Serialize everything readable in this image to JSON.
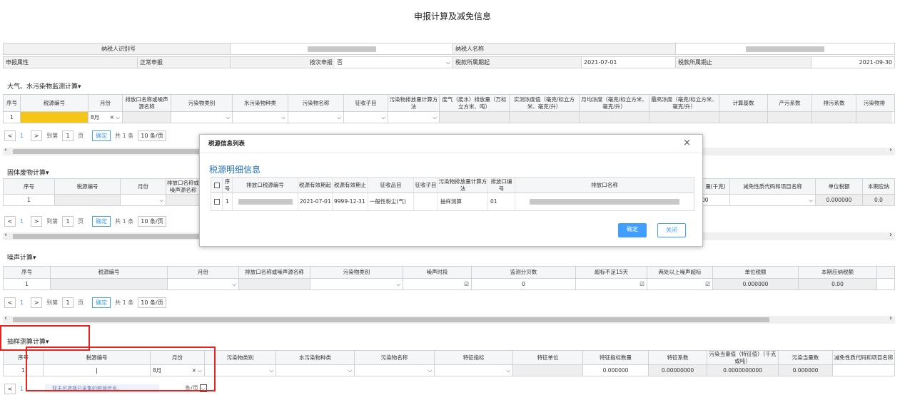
{
  "page_title": "申报计算及减免信息",
  "info": {
    "taxpayer_id_label": "纳税人识别号",
    "taxpayer_name_label": "纳税人名称",
    "declare_type_label": "申报属性",
    "declare_type_value": "正常申报",
    "by_times_label": "按次申报",
    "by_times_value": "否",
    "period_start_label": "税款所属期起",
    "period_start_value": "2021-07-01",
    "period_end_label": "税款所属期止",
    "period_end_value": "2021-09-30"
  },
  "air": {
    "title": "大气、水污染物监测计算▾",
    "headers": [
      "序号",
      "税源编号",
      "月份",
      "排放口名称或噪声源名称",
      "污染物类别",
      "水污染物种类",
      "污染物名称",
      "征收子目",
      "污染物排放量计算方法",
      "废气（废水）排放量（万标立方米、吨）",
      "实测浓度值（毫克/标立方米、毫克/升）",
      "月均浓度（毫克/标立方米、毫克/升）",
      "最高浓度（毫克/标立方米、毫克/升）",
      "计算基数",
      "产污系数",
      "排污系数",
      "污染物排"
    ],
    "row": {
      "no": "1",
      "month": "8月"
    }
  },
  "solid": {
    "title": "固体废物计算▾",
    "headers": [
      "序号",
      "税源编号",
      "月份",
      "排放口名称或噪声源名称",
      "量(千克)",
      "减免性质代码和项目名称",
      "单位税额",
      "本期应纳"
    ],
    "row": {
      "no": "1",
      "qty": "00",
      "unit_tax": "0.000000",
      "tax": "0.0"
    }
  },
  "noise": {
    "title": "噪声计算▾",
    "headers": [
      "序号",
      "税源编号",
      "月份",
      "排放口名称或噪声源名称",
      "污染物类别",
      "噪声时段",
      "监测分贝数",
      "超标不足15天",
      "两处以上噪声超标",
      "单位税额",
      "本期应纳税额"
    ],
    "row": {
      "no": "1",
      "db": "0",
      "unit_tax": "0.000000",
      "tax": "0.00"
    }
  },
  "sample": {
    "title": "抽样测算计算▾",
    "headers": [
      "序号",
      "税源编号",
      "月份",
      "污染物类别",
      "水污染物种类",
      "污染物名称",
      "特征指标",
      "特征单位",
      "特征指标数量",
      "特征系数",
      "污染当量值（特征值）（千克或吨）",
      "污染当量数",
      "减免性质代码和项目名称"
    ],
    "row": {
      "no": "1",
      "month": "8月",
      "qty": "0.000000",
      "coef": "0.00000000",
      "eq": "0.0000000000",
      "eqn": "0.000000"
    },
    "tip": "双击可选择已采集的税源信息。"
  },
  "pager": {
    "prev": "<",
    "page": "1",
    "next": ">",
    "goto": "到第",
    "page_input": "1",
    "page_unit": "页",
    "confirm": "确定",
    "total": "共 1 条",
    "size": "10 条/页",
    "size_short": "条/页"
  },
  "modal": {
    "title": "税源信息列表",
    "close": "×",
    "subtitle": "税源明细信息",
    "headers": [
      "",
      "序号",
      "排放口税源编号",
      "税源有效期起",
      "税源有效期止",
      "征收品目",
      "征收子目",
      "污染物排放量计算方法",
      "排放口编号",
      "排放口名称"
    ],
    "row": {
      "no": "1",
      "start": "2021-07-01",
      "end": "9999-12-31",
      "item": "一般性粉尘(气)",
      "sub": "",
      "method": "抽样测算",
      "code": "01"
    },
    "ok": "确定",
    "cancel": "关闭"
  },
  "colors": {
    "accent": "#409eff",
    "highlight": "#f5c518",
    "red": "#e8231f"
  }
}
